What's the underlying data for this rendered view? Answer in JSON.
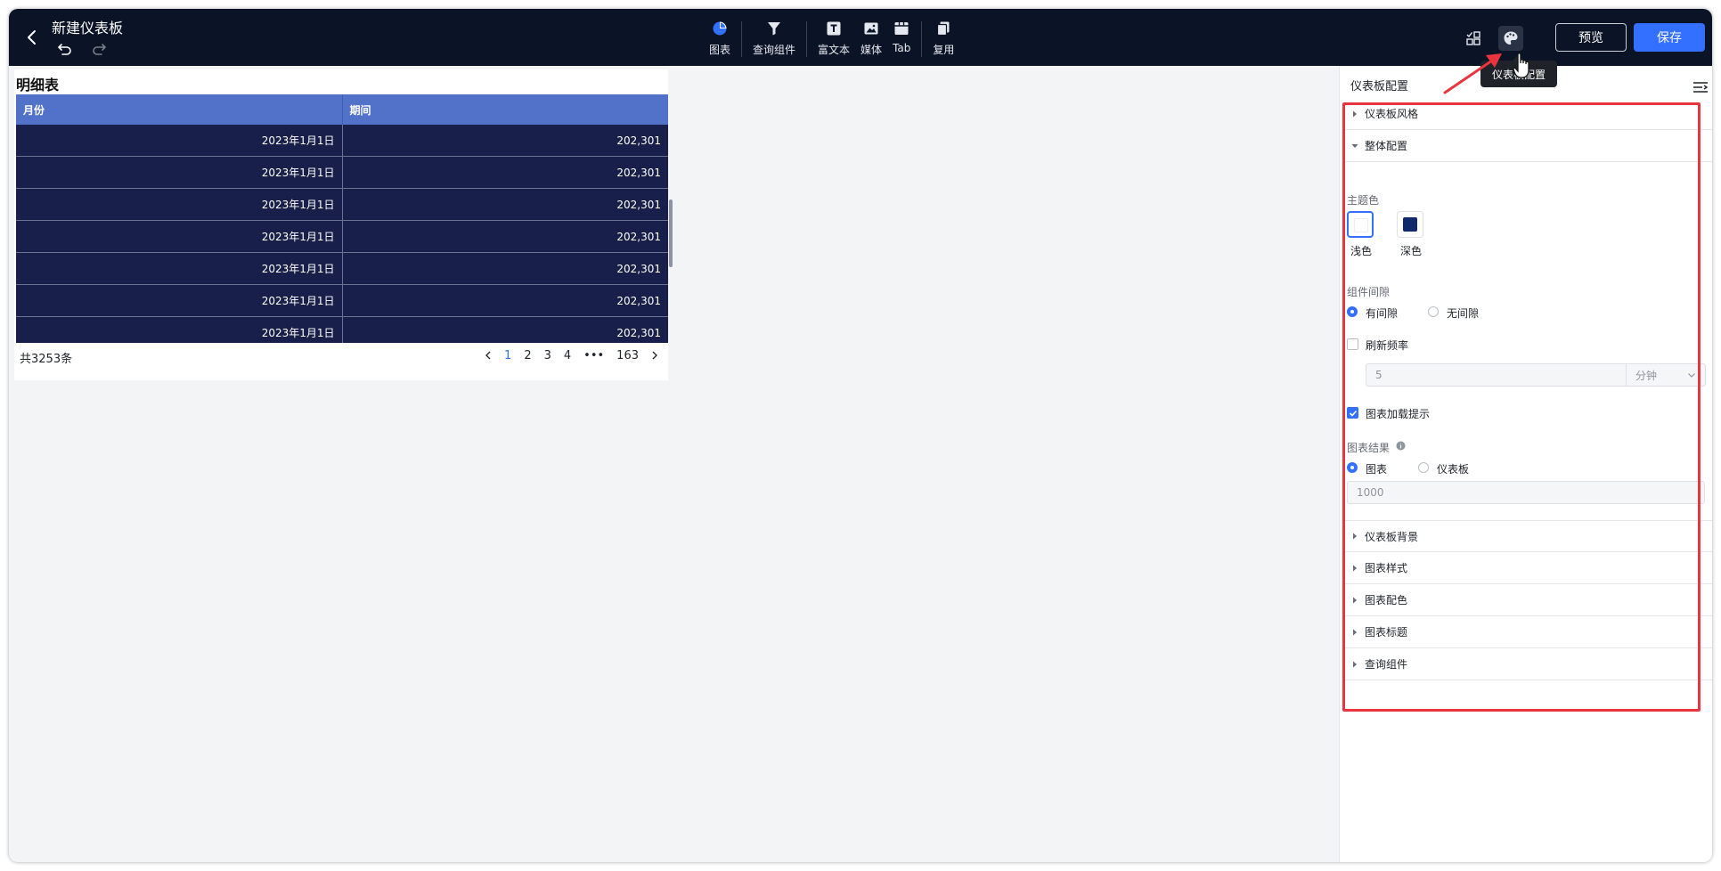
{
  "header": {
    "title": "新建仪表板",
    "tools": [
      {
        "label": "图表",
        "icon": "pie-chart-icon"
      },
      {
        "label": "查询组件",
        "icon": "filter-icon"
      },
      {
        "label": "富文本",
        "icon": "text-icon"
      },
      {
        "label": "媒体",
        "icon": "image-icon"
      },
      {
        "label": "Tab",
        "icon": "tab-icon"
      },
      {
        "label": "复用",
        "icon": "copy-icon"
      }
    ],
    "preview_label": "预览",
    "save_label": "保存",
    "tooltip": "仪表板配置"
  },
  "widget": {
    "title": "明细表",
    "columns": [
      "月份",
      "期间"
    ],
    "rows": [
      [
        "2023年1月1日",
        "202,301"
      ],
      [
        "2023年1月1日",
        "202,301"
      ],
      [
        "2023年1月1日",
        "202,301"
      ],
      [
        "2023年1月1日",
        "202,301"
      ],
      [
        "2023年1月1日",
        "202,301"
      ],
      [
        "2023年1月1日",
        "202,301"
      ],
      [
        "2023年1月1日",
        "202,301"
      ]
    ],
    "total": "共3253条",
    "pages": [
      "1",
      "2",
      "3",
      "4",
      "•••",
      "163"
    ],
    "current_page": "1"
  },
  "panel": {
    "title": "仪表板配置",
    "sections": {
      "style": "仪表板风格",
      "overall": "整体配置",
      "background": "仪表板背景",
      "chart_style": "图表样式",
      "chart_color": "图表配色",
      "chart_title": "图表标题",
      "query": "查询组件"
    },
    "theme": {
      "label": "主题色",
      "light": "浅色",
      "dark": "深色",
      "light_color": "#ffffff",
      "dark_color": "#0f2a6b"
    },
    "spacing": {
      "label": "组件间隙",
      "with_gap": "有间隙",
      "no_gap": "无间隙"
    },
    "refresh": {
      "label": "刷新频率",
      "value": "5",
      "unit": "分钟"
    },
    "loading_hint": "图表加载提示",
    "result": {
      "label": "图表结果",
      "chart": "图表",
      "dashboard": "仪表板",
      "value": "1000"
    }
  },
  "colors": {
    "header_bg": "#0b1426",
    "accent": "#3370ff",
    "table_header": "#5271c9",
    "table_body": "#171f4a",
    "highlight": "#e8353f"
  }
}
